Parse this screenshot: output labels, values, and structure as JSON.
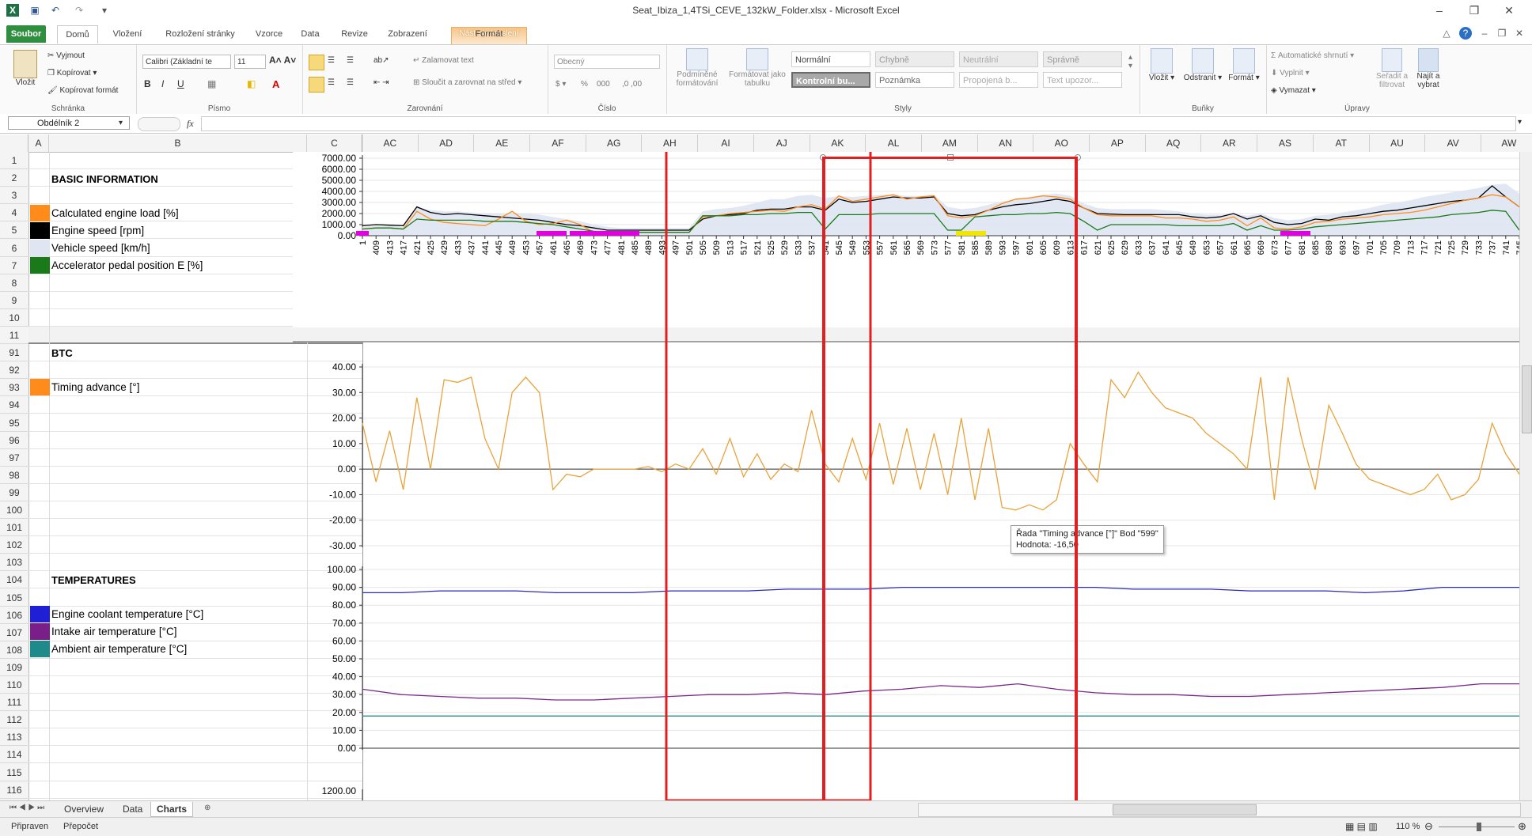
{
  "window": {
    "title": "Seat_Ibiza_1,4TSi_CEVE_132kW_Folder.xlsx  -  Microsoft Excel",
    "context_tab_group": "Nástroje kreslení"
  },
  "ribbon_tabs": [
    "Soubor",
    "Domů",
    "Vložení",
    "Rozložení stránky",
    "Vzorce",
    "Data",
    "Revize",
    "Zobrazení",
    "Formát"
  ],
  "ribbon": {
    "clipboard": {
      "paste": "Vložit",
      "cut": "Vyjmout",
      "copy": "Kopírovat",
      "format_painter": "Kopírovat formát",
      "label": "Schránka"
    },
    "font": {
      "name": "Calibri (Základní te",
      "size": "11",
      "label": "Písmo"
    },
    "alignment": {
      "wrap": "Zalamovat text",
      "merge": "Sloučit a zarovnat na střed",
      "label": "Zarovnání"
    },
    "number": {
      "format": "Obecný",
      "label": "Číslo"
    },
    "styles": {
      "cond_format": "Podmíněné formátování",
      "format_table": "Formátovat jako tabulku",
      "cells": [
        "Normální",
        "Chybně",
        "Neutrální",
        "Správně",
        "Kontrolní bu...",
        "Poznámka",
        "Propojená b...",
        "Text upozor..."
      ],
      "label": "Styly"
    },
    "cells": {
      "insert": "Vložit",
      "delete": "Odstranit",
      "format": "Formát",
      "label": "Buňky"
    },
    "editing": {
      "autosum": "Automatické shrnutí",
      "fill": "Vyplnit",
      "clear": "Vymazat",
      "sort": "Seřadit a filtrovat",
      "find": "Najít a vybrat",
      "label": "Úpravy"
    }
  },
  "formula_bar": {
    "name_box": "Obdélník 2",
    "fx": "fx",
    "formula": ""
  },
  "columns_left": [
    "A",
    "B",
    "C"
  ],
  "columns_right": [
    "AC",
    "AD",
    "AE",
    "AF",
    "AG",
    "AH",
    "AI",
    "AJ",
    "AK",
    "AL",
    "AM",
    "AN",
    "AO",
    "AP",
    "AQ",
    "AR",
    "AS",
    "AT",
    "AU",
    "AV",
    "AW"
  ],
  "rows": [
    "1",
    "2",
    "3",
    "4",
    "5",
    "6",
    "7",
    "8",
    "9",
    "10",
    "11",
    "91",
    "92",
    "93",
    "94",
    "95",
    "96",
    "97",
    "98",
    "99",
    "100",
    "101",
    "102",
    "103",
    "104",
    "105",
    "106",
    "107",
    "108",
    "109",
    "110",
    "111",
    "112",
    "113",
    "114",
    "115",
    "116"
  ],
  "sections": {
    "basic": {
      "title": "BASIC INFORMATION",
      "items": [
        {
          "label": "Calculated engine load [%]",
          "color": "#ff8c1a"
        },
        {
          "label": "Engine speed [rpm]",
          "color": "#000000"
        },
        {
          "label": "Vehicle speed [km/h]",
          "color": "#dfe6f2"
        },
        {
          "label": "Accelerator pedal position E [%]",
          "color": "#1a7a1a"
        }
      ]
    },
    "btc": {
      "title": "BTC",
      "items": [
        {
          "label": "Timing advance [°]",
          "color": "#ff8c1a"
        }
      ]
    },
    "temps": {
      "title": "TEMPERATURES",
      "items": [
        {
          "label": "Engine coolant temperature [°C]",
          "color": "#1f1fd6"
        },
        {
          "label": "Intake air temperature [°C]",
          "color": "#7a1f8a"
        },
        {
          "label": "Ambient air temperature [°C]",
          "color": "#1f8a8a"
        }
      ]
    }
  },
  "chart_data": [
    {
      "type": "line",
      "title": "BASIC INFORMATION",
      "y_ticks": [
        "7000.00",
        "6000.00",
        "5000.00",
        "4000.00",
        "3000.00",
        "2000.00",
        "1000.00",
        "0.00"
      ],
      "ylim": [
        0,
        7000
      ],
      "x_tick_labels": [
        "1",
        "409",
        "413",
        "417",
        "421",
        "425",
        "429",
        "433",
        "437",
        "441",
        "445",
        "449",
        "453",
        "457",
        "461",
        "465",
        "469",
        "473",
        "477",
        "481",
        "485",
        "489",
        "493",
        "497",
        "501",
        "505",
        "509",
        "513",
        "517",
        "521",
        "525",
        "529",
        "533",
        "537",
        "541",
        "545",
        "549",
        "553",
        "557",
        "561",
        "565",
        "569",
        "573",
        "577",
        "581",
        "585",
        "589",
        "593",
        "597",
        "601",
        "605",
        "609",
        "613",
        "617",
        "621",
        "625",
        "629",
        "633",
        "637",
        "641",
        "645",
        "649",
        "653",
        "657",
        "661",
        "665",
        "669",
        "673",
        "677",
        "681",
        "685",
        "689",
        "693",
        "697",
        "701",
        "705",
        "709",
        "713",
        "717",
        "721",
        "725",
        "729",
        "733",
        "737",
        "741",
        "745"
      ],
      "series": [
        {
          "name": "Engine speed [rpm]",
          "color": "#000000",
          "values": [
            900,
            1000,
            950,
            900,
            2600,
            2100,
            1900,
            2000,
            1900,
            1800,
            1700,
            1600,
            1500,
            1400,
            1200,
            1000,
            900,
            700,
            500,
            500,
            500,
            500,
            500,
            500,
            500,
            1500,
            1800,
            1900,
            2000,
            2300,
            2400,
            2400,
            2600,
            2600,
            2300,
            3300,
            3000,
            3100,
            3300,
            3500,
            3400,
            3400,
            3500,
            2000,
            1800,
            1900,
            2300,
            2600,
            2800,
            2900,
            3100,
            3300,
            3100,
            2500,
            2000,
            1950,
            1900,
            1900,
            1900,
            1900,
            1900,
            1700,
            1600,
            1700,
            2000,
            1500,
            1800,
            1200,
            1000,
            1100,
            1500,
            1400,
            1700,
            1800,
            2000,
            2200,
            2300,
            2500,
            2700,
            2900,
            3100,
            3200,
            3400,
            4500,
            3500,
            2600
          ]
        },
        {
          "name": "Calculated engine load [%]",
          "color": "#ff8c1a",
          "values": [
            600,
            700,
            700,
            600,
            2200,
            1500,
            1200,
            1100,
            1000,
            900,
            1500,
            2200,
            1300,
            1000,
            1100,
            1400,
            1000,
            300,
            300,
            300,
            300,
            300,
            300,
            300,
            300,
            1700,
            1800,
            2000,
            2100,
            2200,
            2300,
            2200,
            2600,
            2800,
            2400,
            3600,
            3100,
            3300,
            3500,
            3700,
            3300,
            3500,
            3600,
            1800,
            1600,
            1800,
            2300,
            2900,
            3300,
            3400,
            3600,
            3500,
            3300,
            2500,
            1900,
            1800,
            1800,
            1800,
            1800,
            1600,
            1600,
            1500,
            1300,
            1400,
            1700,
            900,
            1600,
            700,
            600,
            800,
            1200,
            1300,
            1500,
            1600,
            1700,
            1900,
            2000,
            2100,
            2300,
            2600,
            2900,
            3200,
            3400,
            3700,
            3500,
            2600
          ]
        },
        {
          "name": "Vehicle speed [km/h]",
          "color": "#dfe6f2",
          "values": [
            800,
            900,
            900,
            800,
            2600,
            2300,
            2200,
            2200,
            2100,
            2000,
            2000,
            2100,
            2000,
            1900,
            1700,
            1500,
            1300,
            1000,
            800,
            700,
            700,
            700,
            700,
            700,
            700,
            2200,
            2400,
            2500,
            2700,
            3000,
            3300,
            3300,
            3600,
            3700,
            3400,
            3600,
            3500,
            3600,
            3700,
            3700,
            3600,
            3600,
            3700,
            2600,
            2400,
            2500,
            2800,
            3100,
            3300,
            3500,
            3700,
            3800,
            3600,
            2900,
            2500,
            2400,
            2400,
            2400,
            2400,
            2300,
            2200,
            2000,
            1900,
            1900,
            2000,
            1800,
            2000,
            1600,
            1400,
            1500,
            1800,
            1900,
            2100,
            2300,
            2500,
            2800,
            3000,
            3200,
            3500,
            3700,
            3900,
            4100,
            4300,
            4600,
            4700,
            3800
          ]
        },
        {
          "name": "Accelerator pedal position E [%]",
          "color": "#1a7a1a",
          "values": [
            600,
            700,
            700,
            600,
            1500,
            1400,
            1400,
            1400,
            1400,
            1300,
            1300,
            1300,
            1200,
            1100,
            1000,
            800,
            600,
            400,
            300,
            300,
            300,
            300,
            300,
            300,
            300,
            1800,
            1800,
            1800,
            1900,
            1900,
            2000,
            2000,
            2100,
            2100,
            600,
            1900,
            1900,
            1900,
            2000,
            2000,
            2000,
            2000,
            2000,
            500,
            500,
            1700,
            1800,
            1900,
            1900,
            2000,
            2000,
            2100,
            2000,
            1300,
            500,
            1000,
            1000,
            1000,
            1000,
            1000,
            900,
            900,
            900,
            900,
            1100,
            500,
            900,
            500,
            500,
            600,
            800,
            900,
            1000,
            1100,
            1200,
            1300,
            1400,
            1500,
            1600,
            1700,
            1900,
            2000,
            2100,
            2300,
            2200,
            500
          ]
        }
      ]
    },
    {
      "type": "line",
      "title": "BTC",
      "y_ticks": [
        "40.00",
        "30.00",
        "20.00",
        "10.00",
        "0.00",
        "-10.00",
        "-20.00",
        "-30.00"
      ],
      "ylim": [
        -30,
        40
      ],
      "series": [
        {
          "name": "Timing advance [°]",
          "color": "#e8a33c",
          "values": [
            18,
            -5,
            15,
            -8,
            28,
            0,
            35,
            34,
            36,
            12,
            0,
            30,
            36,
            30,
            -8,
            -2,
            -3,
            0,
            0,
            0,
            0,
            1,
            -1,
            2,
            0,
            8,
            -2,
            12,
            -3,
            6,
            -4,
            2,
            -1,
            23,
            2,
            -5,
            12,
            -4,
            18,
            -6,
            16,
            -8,
            14,
            -10,
            20,
            -12,
            16,
            -15,
            -16,
            -14,
            -16,
            -12,
            10,
            2,
            -5,
            35,
            28,
            38,
            30,
            24,
            22,
            20,
            14,
            10,
            6,
            0,
            36,
            -12,
            36,
            12,
            -8,
            25,
            14,
            2,
            -4,
            -6,
            -8,
            -10,
            -8,
            -2,
            -12,
            -10,
            -4,
            18,
            6,
            -2
          ]
        }
      ]
    },
    {
      "type": "line",
      "title": "TEMPERATURES",
      "y_ticks": [
        "100.00",
        "90.00",
        "80.00",
        "70.00",
        "60.00",
        "50.00",
        "40.00",
        "30.00",
        "20.00",
        "10.00",
        "0.00"
      ],
      "ylim": [
        0,
        100
      ],
      "series": [
        {
          "name": "Engine coolant temperature [°C]",
          "color": "#2a2ab8",
          "values": [
            87,
            87,
            88,
            88,
            88,
            87,
            87,
            87,
            88,
            88,
            88,
            89,
            89,
            89,
            90,
            90,
            90,
            90,
            90,
            90,
            89,
            89,
            89,
            88,
            88,
            88,
            87,
            88,
            90,
            90,
            90
          ]
        },
        {
          "name": "Intake air temperature [°C]",
          "color": "#7a2a8a",
          "values": [
            33,
            30,
            29,
            28,
            28,
            27,
            27,
            28,
            29,
            30,
            30,
            31,
            30,
            32,
            33,
            35,
            34,
            36,
            33,
            31,
            30,
            30,
            29,
            29,
            30,
            31,
            32,
            33,
            34,
            36,
            36
          ]
        },
        {
          "name": "Ambient air temperature [°C]",
          "color": "#2a8a8a",
          "values": [
            18,
            18,
            18,
            18,
            18,
            18,
            18,
            18,
            18,
            18,
            18,
            18,
            18,
            18,
            18,
            18,
            18,
            18,
            18,
            18,
            18,
            18,
            18,
            18,
            18,
            18,
            18,
            18,
            18,
            18,
            18
          ]
        }
      ]
    }
  ],
  "partial_axis_label": "1200.00",
  "tooltip": {
    "line1": "Řada \"Timing advance [°]\" Bod \"599\"",
    "line2": "Hodnota: -16,50"
  },
  "sheet_tabs": [
    "Overview",
    "Data",
    "Charts"
  ],
  "active_sheet": "Charts",
  "status": {
    "ready": "Připraven",
    "recalc": "Přepočet",
    "zoom": "110 %"
  }
}
